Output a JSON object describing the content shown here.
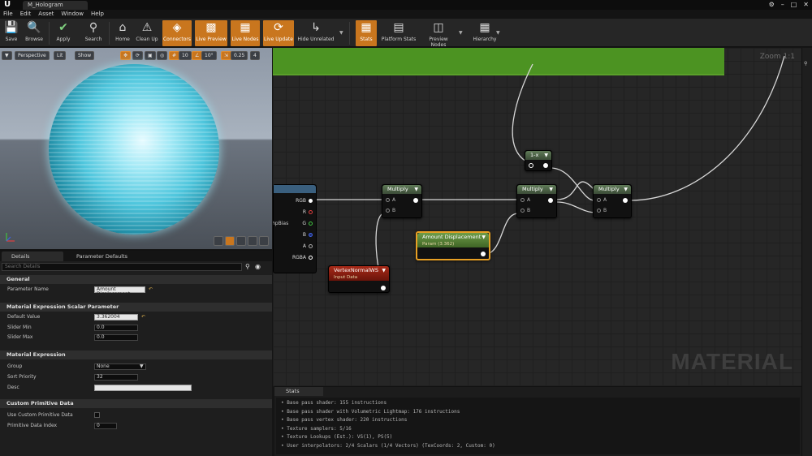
{
  "window": {
    "tab_title": "M_Hologram",
    "controls": [
      "⚙",
      "–",
      "□",
      "✕"
    ]
  },
  "menu": [
    "File",
    "Edit",
    "Asset",
    "Window",
    "Help"
  ],
  "toolbar": {
    "save": "Save",
    "browse": "Browse",
    "apply": "Apply",
    "search": "Search",
    "home": "Home",
    "clean_up": "Clean Up",
    "connectors": "Connectors",
    "live_preview": "Live Preview",
    "live_nodes": "Live Nodes",
    "live_update": "Live Update",
    "hide_unrelated": "Hide Unrelated",
    "stats": "Stats",
    "platform_stats": "Platform Stats",
    "preview_nodes": "Preview Nodes",
    "hierarchy": "Hierarchy"
  },
  "viewport": {
    "perspective": "Perspective",
    "lit": "Lit",
    "show": "Show",
    "grid_snap": "10",
    "rot_snap": "10°",
    "scale_snap": "0.25",
    "cam_speed": "4"
  },
  "details": {
    "tabs": [
      "Details",
      "Parameter Defaults"
    ],
    "search_placeholder": "Search Details",
    "sections": {
      "general": "General",
      "scalar": "Material Expression Scalar Parameter",
      "expression": "Material Expression",
      "custom": "Custom Primitive Data"
    },
    "props": {
      "parameter_name_label": "Parameter Name",
      "parameter_name_value": "Amount Displacement",
      "default_value_label": "Default Value",
      "default_value_value": "3.362004",
      "slider_min_label": "Slider Min",
      "slider_min_value": "0.0",
      "slider_max_label": "Slider Max",
      "slider_max_value": "0.0",
      "group_label": "Group",
      "group_value": "None",
      "sort_priority_label": "Sort Priority",
      "sort_priority_value": "32",
      "desc_label": "Desc",
      "desc_value": "",
      "use_custom_label": "Use Custom Primitive Data",
      "primitive_index_label": "Primitive Data Index",
      "primitive_index_value": "0"
    }
  },
  "graph": {
    "zoom": "Zoom 1:1",
    "watermark": "MATERIAL",
    "tex_node": {
      "side_label": "hpBias",
      "pins": [
        "RGB",
        "R",
        "G",
        "B",
        "A",
        "RGBA"
      ]
    },
    "nodes": {
      "multiply_1": "Multiply",
      "multiply_2": "Multiply",
      "multiply_3": "Multiply",
      "one_minus": "1-x",
      "amount_title": "Amount Displacement",
      "amount_sub": "Param (3.362)",
      "vertex_title": "VertexNormalWS",
      "vertex_sub": "Input Data",
      "pin_a": "A",
      "pin_b": "B"
    }
  },
  "stats": {
    "tab": "Stats",
    "lines": [
      "Base pass shader: 155 instructions",
      "Base pass shader with Volumetric Lightmap: 176 instructions",
      "Base pass vertex shader: 220 instructions",
      "Texture samplers: 5/16",
      "Texture Lookups (Est.): VS(1), PS(5)",
      "User interpolators: 2/4 Scalars (1/4 Vectors) (TexCoords: 2, Custom: 0)"
    ]
  },
  "colors": {
    "accent_orange": "#c9761e",
    "comment_green": "#4c9322",
    "param_node": "#5c8a3a",
    "vertex_node": "#8c1f12"
  }
}
